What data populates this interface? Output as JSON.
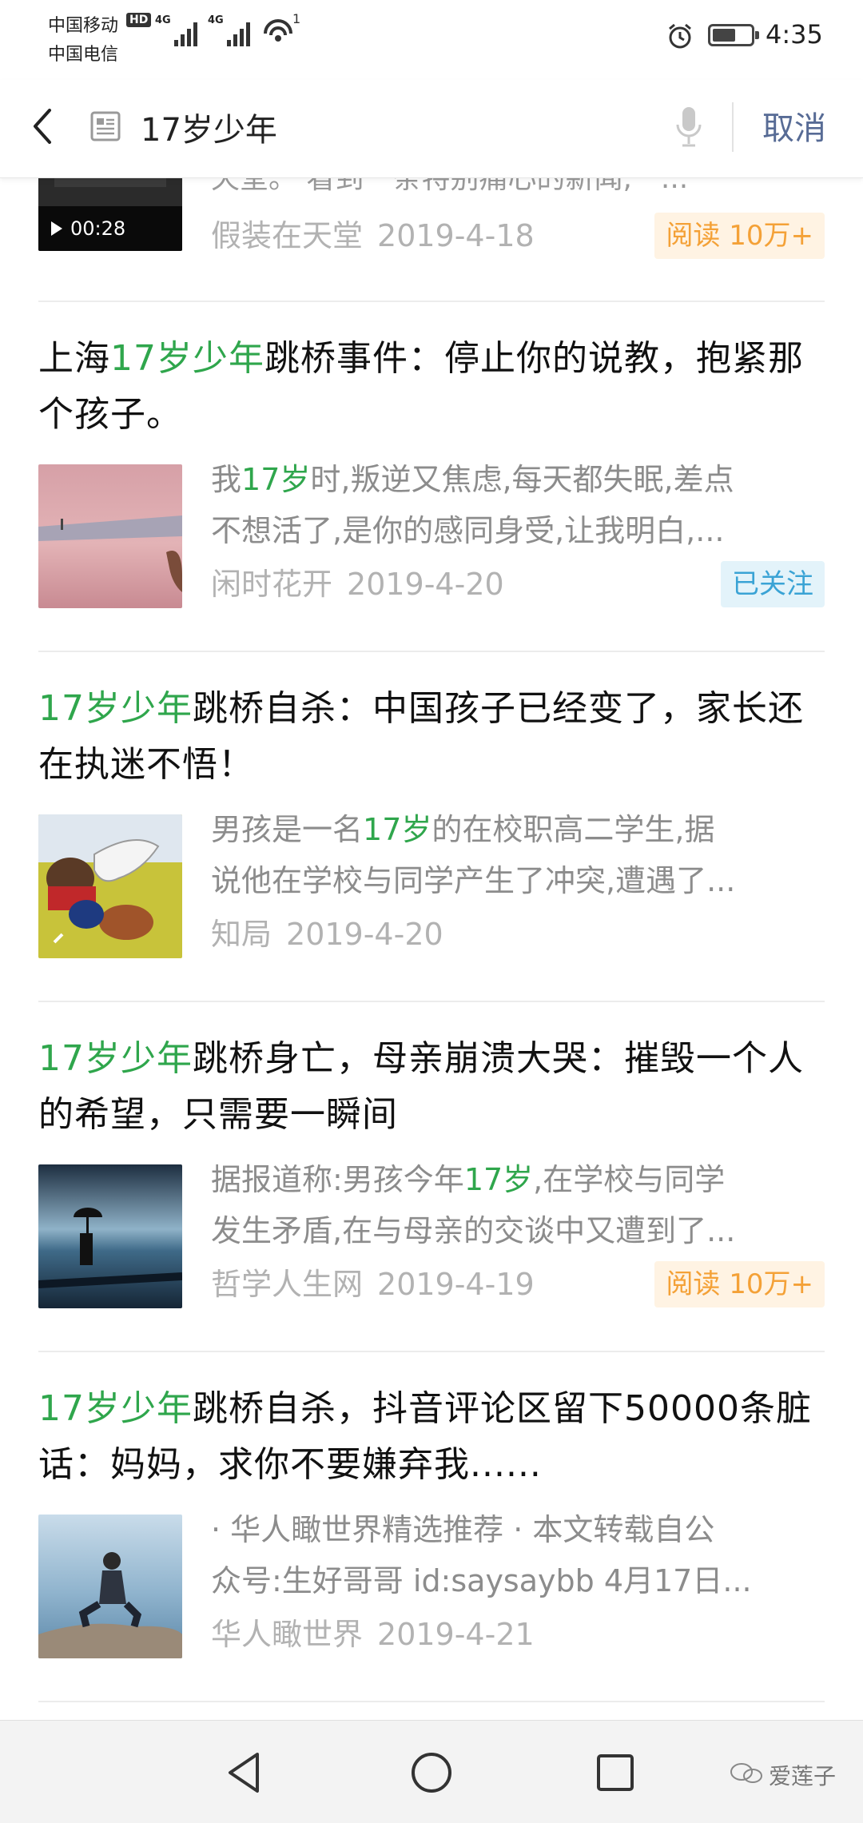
{
  "status_bar": {
    "carrier_1": "中国移动",
    "carrier_2": "中国电信",
    "hd_badge": "HD",
    "signal_1_label": "4G",
    "signal_2_label": "4G",
    "wifi_badge": "1",
    "time": "4:35",
    "battery_level": 0.6
  },
  "search_header": {
    "query": "17岁少年",
    "cancel_label": "取消"
  },
  "partial_item": {
    "snippet": "天堂。 看到一条特别痛心的新闻,一...",
    "video_duration": "00:28",
    "source": "假装在天堂",
    "date": "2019-4-18",
    "badge": "阅读 10万+"
  },
  "results": [
    {
      "title_before": "上海",
      "title_highlight": "17岁少年",
      "title_after": "跳桥事件：停止你的说教，抱紧那个孩子。",
      "snippet_line1_before": "我",
      "snippet_line1_highlight": "17岁",
      "snippet_line1_after": "时,叛逆又焦虑,每天都失眠,差点",
      "snippet_line2": "不想活了,是你的感同身受,让我明白,...",
      "source": "闲时花开",
      "date": "2019-4-20",
      "badge": "已关注",
      "badge_type": "follow",
      "thumb_image": "pink-sky-figure-image"
    },
    {
      "title_before": "",
      "title_highlight": "17岁少年",
      "title_after": "跳桥自杀：中国孩子已经变了，家长还在执迷不悟！",
      "snippet_line1_before": "男孩是一名",
      "snippet_line1_highlight": "17岁",
      "snippet_line1_after": "的在校职高二学生,据",
      "snippet_line2": "说他在学校与同学产生了冲突,遭遇了...",
      "source": "知局",
      "date": "2019-4-20",
      "badge": "",
      "badge_type": "",
      "thumb_image": "cartoon-angel-image"
    },
    {
      "title_before": "",
      "title_highlight": "17岁少年",
      "title_after": "跳桥身亡，母亲崩溃大哭：摧毁一个人的希望，只需要一瞬间",
      "snippet_line1_before": "据报道称:男孩今年",
      "snippet_line1_highlight": "17岁",
      "snippet_line1_after": ",在学校与同学",
      "snippet_line2": "发生矛盾,在与母亲的交谈中又遭到了...",
      "source": "哲学人生网",
      "date": "2019-4-19",
      "badge": "阅读 10万+",
      "badge_type": "read",
      "thumb_image": "umbrella-seaside-image"
    },
    {
      "title_before": "",
      "title_highlight": "17岁少年",
      "title_after": "跳桥自杀，抖音评论区留下50000条脏话：妈妈，求你不要嫌弃我......",
      "snippet_line1_before": "· 华人瞰世界精选推荐 · 本文转载自公",
      "snippet_line1_highlight": "",
      "snippet_line1_after": "",
      "snippet_line2": "众号:生好哥哥 id:saysaybb 4月17日...",
      "source": "华人瞰世界",
      "date": "2019-4-21",
      "badge": "",
      "badge_type": "",
      "thumb_image": "man-on-rocks-image"
    }
  ],
  "nav_bar": {
    "watermark": "爱莲子"
  },
  "colors": {
    "highlight_green": "#2fa64c",
    "cancel_blue": "#576b95",
    "read_badge_orange": "#f4a137",
    "follow_badge_blue": "#3aa3d5",
    "meta_gray": "#b2b2b2"
  }
}
